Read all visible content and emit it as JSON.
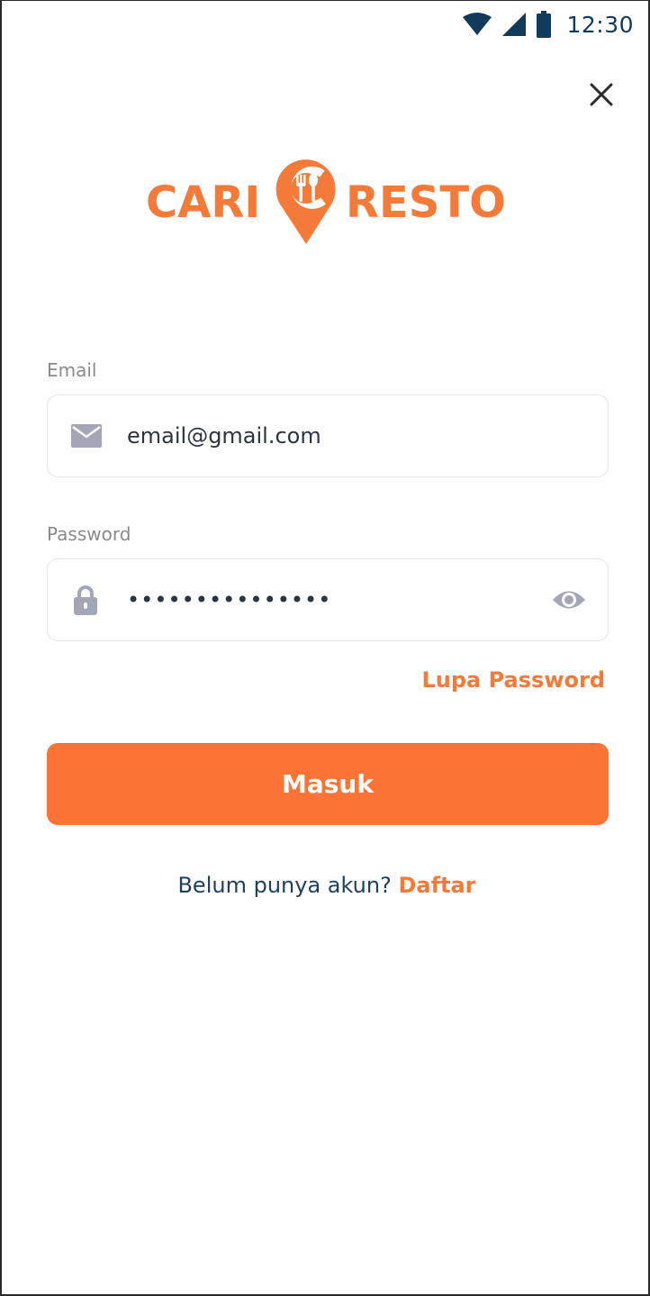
{
  "status_bar": {
    "time": "12:30",
    "icons": [
      "wifi-icon",
      "cell-signal-icon",
      "battery-icon"
    ]
  },
  "header": {
    "close_icon": "close-icon"
  },
  "logo": {
    "word_left": "CARI",
    "word_right": "RESTO",
    "brand_color": "#f47a3a"
  },
  "form": {
    "email": {
      "label": "Email",
      "value": "email@gmail.com",
      "icon": "mail-icon"
    },
    "password": {
      "label": "Password",
      "value": "•••••••••••••••",
      "icon": "lock-icon",
      "toggle_icon": "eye-icon"
    },
    "forgot_label": "Lupa Password",
    "submit_label": "Masuk"
  },
  "footer": {
    "question": "Belum punya akun?",
    "signup_label": "Daftar"
  },
  "colors": {
    "accent": "#fb7436",
    "text_dark": "#1f3f5e",
    "label": "#8a8a8a",
    "icon_gray": "#a3a6b7"
  }
}
